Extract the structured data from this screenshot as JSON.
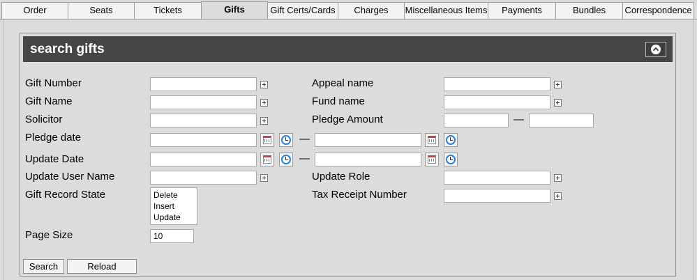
{
  "tabs": [
    {
      "label": "Order",
      "active": false
    },
    {
      "label": "Seats",
      "active": false
    },
    {
      "label": "Tickets",
      "active": false
    },
    {
      "label": "Gifts",
      "active": true
    },
    {
      "label": "Gift Certs/Cards",
      "active": false
    },
    {
      "label": "Charges",
      "active": false
    },
    {
      "label": "Miscellaneous Items",
      "active": false
    },
    {
      "label": "Payments",
      "active": false
    },
    {
      "label": "Bundles",
      "active": false
    },
    {
      "label": "Correspondence",
      "active": false
    }
  ],
  "panel": {
    "title": "search gifts"
  },
  "fields": {
    "gift_number": {
      "label": "Gift Number",
      "value": ""
    },
    "gift_name": {
      "label": "Gift Name",
      "value": ""
    },
    "solicitor": {
      "label": "Solicitor",
      "value": ""
    },
    "pledge_date": {
      "label": "Pledge date",
      "from": "",
      "to": ""
    },
    "update_date": {
      "label": "Update Date",
      "from": "",
      "to": ""
    },
    "update_user_name": {
      "label": "Update User Name",
      "value": ""
    },
    "gift_record_state": {
      "label": "Gift Record State",
      "options": [
        "Delete",
        "Insert",
        "Update"
      ]
    },
    "page_size": {
      "label": "Page Size",
      "value": "10"
    },
    "appeal_name": {
      "label": "Appeal name",
      "value": ""
    },
    "fund_name": {
      "label": "Fund name",
      "value": ""
    },
    "pledge_amount": {
      "label": "Pledge Amount",
      "from": "",
      "to": ""
    },
    "update_role": {
      "label": "Update Role",
      "value": ""
    },
    "tax_receipt_number": {
      "label": "Tax Receipt Number",
      "value": ""
    }
  },
  "range_separator": "—",
  "buttons": {
    "search": "Search",
    "reload": "Reload"
  }
}
